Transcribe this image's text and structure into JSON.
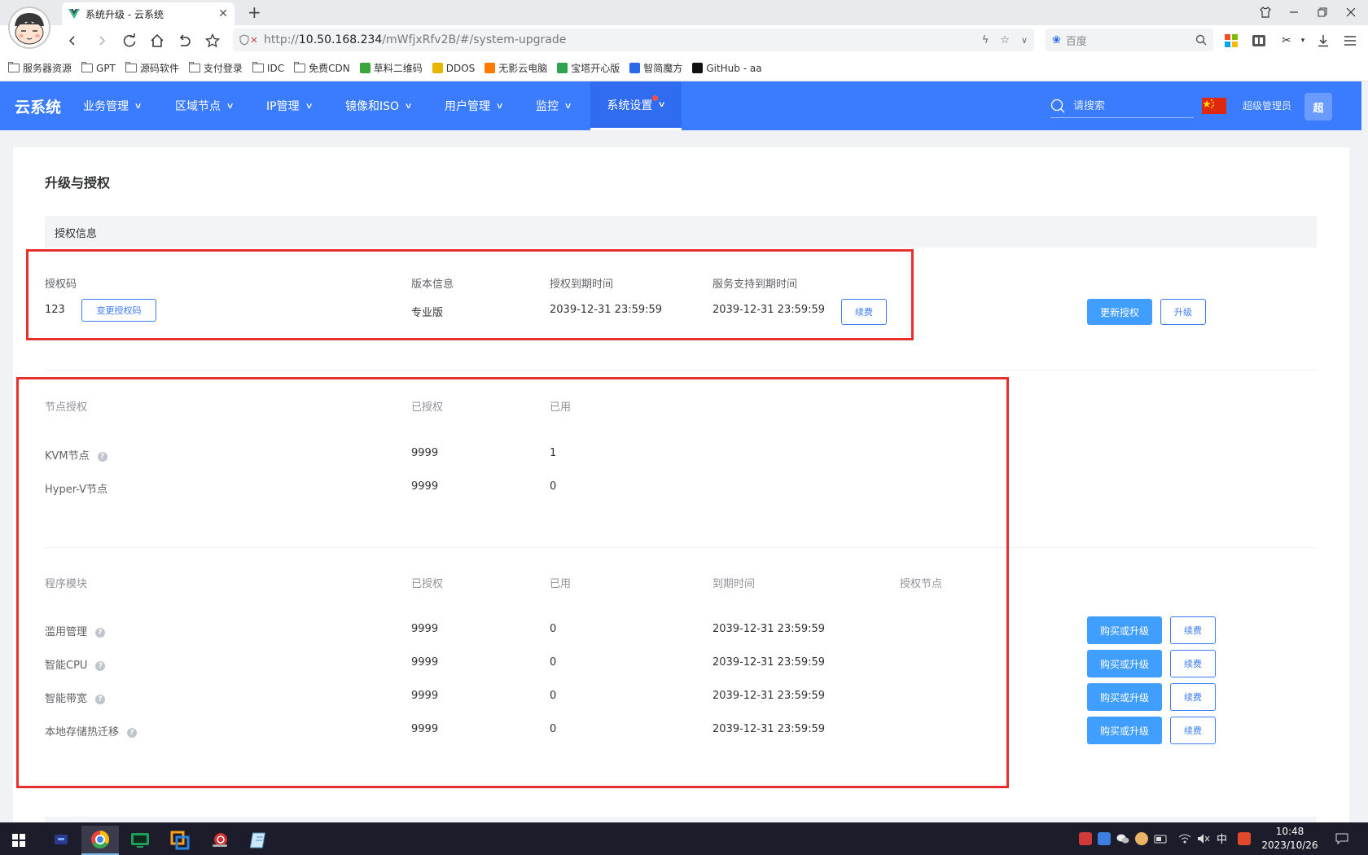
{
  "browser": {
    "tab_title": "系统升级 - 云系统",
    "url_prefix": "http://",
    "url_host": "10.50.168.234",
    "url_path": "/mWfjxRfv2B/#/system-upgrade",
    "search_engine_placeholder": "百度",
    "bookmarks": [
      {
        "label": "服务器资源",
        "icon": "folder-icon"
      },
      {
        "label": "GPT",
        "icon": "folder-icon"
      },
      {
        "label": "源码软件",
        "icon": "folder-icon"
      },
      {
        "label": "支付登录",
        "icon": "folder-icon"
      },
      {
        "label": "IDC",
        "icon": "folder-icon"
      },
      {
        "label": "免费CDN",
        "icon": "folder-icon"
      },
      {
        "label": "草料二维码",
        "icon": "qr-icon"
      },
      {
        "label": "DDOS",
        "icon": "crown-icon"
      },
      {
        "label": "无影云电脑",
        "icon": "wuying-icon"
      },
      {
        "label": "宝塔开心版",
        "icon": "shield-icon"
      },
      {
        "label": "智简魔方",
        "icon": "mofang-icon"
      },
      {
        "label": "GitHub - aa",
        "icon": "github-icon"
      }
    ]
  },
  "app": {
    "logo": "云系统",
    "menu": [
      {
        "label": "业务管理"
      },
      {
        "label": "区域节点"
      },
      {
        "label": "IP管理"
      },
      {
        "label": "镜像和ISO"
      },
      {
        "label": "用户管理"
      },
      {
        "label": "监控"
      },
      {
        "label": "系统设置",
        "active": true,
        "badge": true
      }
    ],
    "search_placeholder": "请搜索",
    "admin_name": "超级管理员",
    "admin_avatar": "超"
  },
  "page": {
    "title": "升级与授权",
    "auth_section_title": "授权信息",
    "auth": {
      "code_label": "授权码",
      "code_value": "123",
      "change_code_button": "变更授权码",
      "version_label": "版本信息",
      "version_value": "专业版",
      "expire_label": "授权到期时间",
      "expire_value": "2039-12-31 23:59:59",
      "support_label": "服务支持到期时间",
      "support_value": "2039-12-31 23:59:59",
      "renew_button": "续费",
      "update_auth_button": "更新授权",
      "upgrade_button": "升级"
    },
    "nodes": {
      "headers": [
        "节点授权",
        "已授权",
        "已用"
      ],
      "rows": [
        {
          "name": "KVM节点",
          "help": true,
          "authorized": "9999",
          "used": "1"
        },
        {
          "name": "Hyper-V节点",
          "help": false,
          "authorized": "9999",
          "used": "0"
        }
      ]
    },
    "modules": {
      "headers": [
        "程序模块",
        "已授权",
        "已用",
        "到期时间",
        "授权节点"
      ],
      "buy_button": "购买或升级",
      "renew_button": "续费",
      "rows": [
        {
          "name": "滥用管理",
          "authorized": "9999",
          "used": "0",
          "expire": "2039-12-31 23:59:59"
        },
        {
          "name": "智能CPU",
          "authorized": "9999",
          "used": "0",
          "expire": "2039-12-31 23:59:59"
        },
        {
          "name": "智能带宽",
          "authorized": "9999",
          "used": "0",
          "expire": "2039-12-31 23:59:59"
        },
        {
          "name": "本地存储热迁移",
          "authorized": "9999",
          "used": "0",
          "expire": "2039-12-31 23:59:59"
        }
      ]
    }
  },
  "taskbar": {
    "time": "10:48",
    "date": "2023/10/26",
    "ime": "中"
  },
  "colors": {
    "header_blue": "#3a7cfd",
    "primary_button": "#409eff",
    "annotation_red": "#e5302e"
  }
}
